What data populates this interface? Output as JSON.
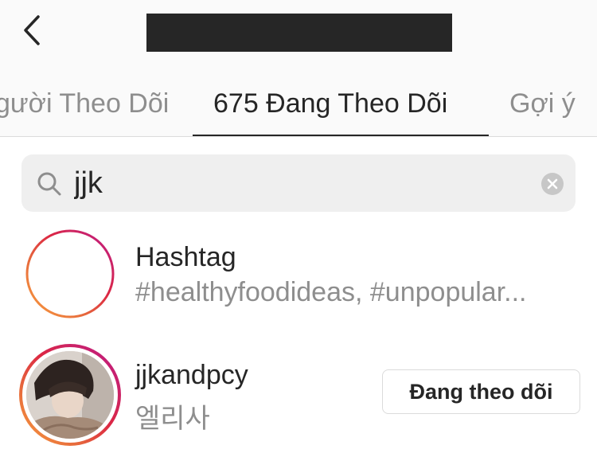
{
  "header": {
    "back_icon": "chevron-left-icon",
    "title": ""
  },
  "tabs": [
    {
      "label": "gười Theo Dõi",
      "active": false
    },
    {
      "label": "675 Đang Theo Dõi",
      "active": true
    },
    {
      "label": "Gợi ý",
      "active": false
    }
  ],
  "search": {
    "value": "jjk",
    "icon": "search-icon",
    "clear_icon": "clear-icon"
  },
  "results": [
    {
      "type": "hashtag",
      "title": "Hashtag",
      "subtitle": "#healthyfoodideas, #unpopular...",
      "icon": "hashtag-icon"
    },
    {
      "type": "user",
      "username": "jjkandpcy",
      "display_name": "엘리사",
      "button_label": "Đang theo dõi"
    }
  ],
  "colors": {
    "text": "#262626",
    "muted": "#8e8e8e",
    "search_bg": "#efefef",
    "gradient": [
      "#f9a03f",
      "#e6683c",
      "#dc2743",
      "#cc2366",
      "#bc1888"
    ]
  }
}
